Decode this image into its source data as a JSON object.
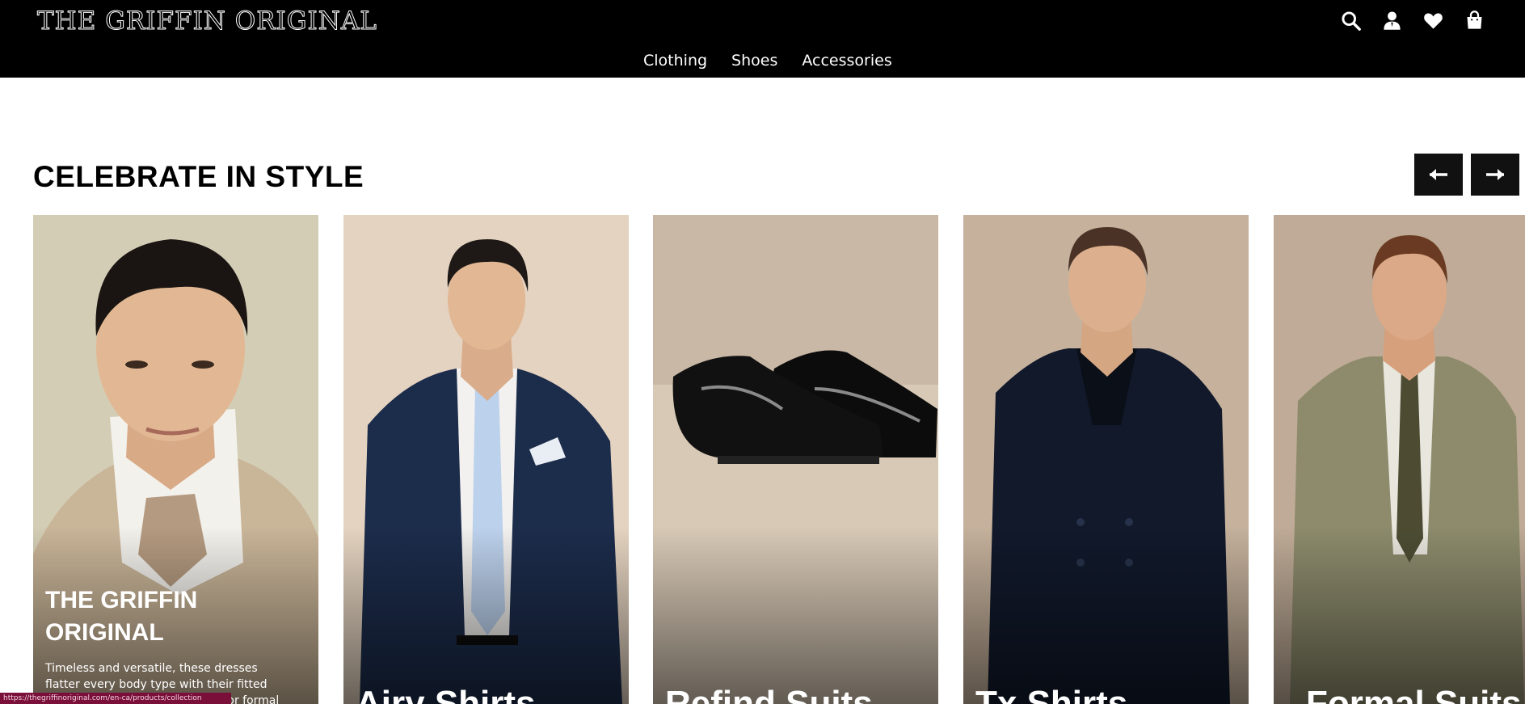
{
  "header": {
    "logo": "THE GRIFFIN ORIGINAL",
    "icons": [
      "search-icon",
      "account-icon",
      "heart-icon",
      "bag-icon"
    ],
    "nav": [
      "Clothing",
      "Shoes",
      "Accessories"
    ]
  },
  "section": {
    "title": "CELEBRATE IN STYLE",
    "prev_icon": "arrow-left-icon",
    "next_icon": "arrow-right-icon"
  },
  "cards": [
    {
      "title": "THE GRIFFIN ORIGINAL",
      "description": "Timeless and versatile, these dresses flatter every body type with their fitted bodice and flared skirt, perfect for formal and casual",
      "bg": "#d8d3c0"
    },
    {
      "title": "Airy Shirts",
      "bg": "#e3d4c2"
    },
    {
      "title": "Refind Suits",
      "bg": "#cdbba8"
    },
    {
      "title": "Tx Shirts",
      "bg": "#c2ae99"
    },
    {
      "title": "Formal Suits",
      "bg": "#bda996"
    }
  ],
  "status": "https://thegriffinoriginal.com/en-ca/products/collection",
  "colors": {
    "topbar": "#000000",
    "accent": "#7a0f3a"
  }
}
